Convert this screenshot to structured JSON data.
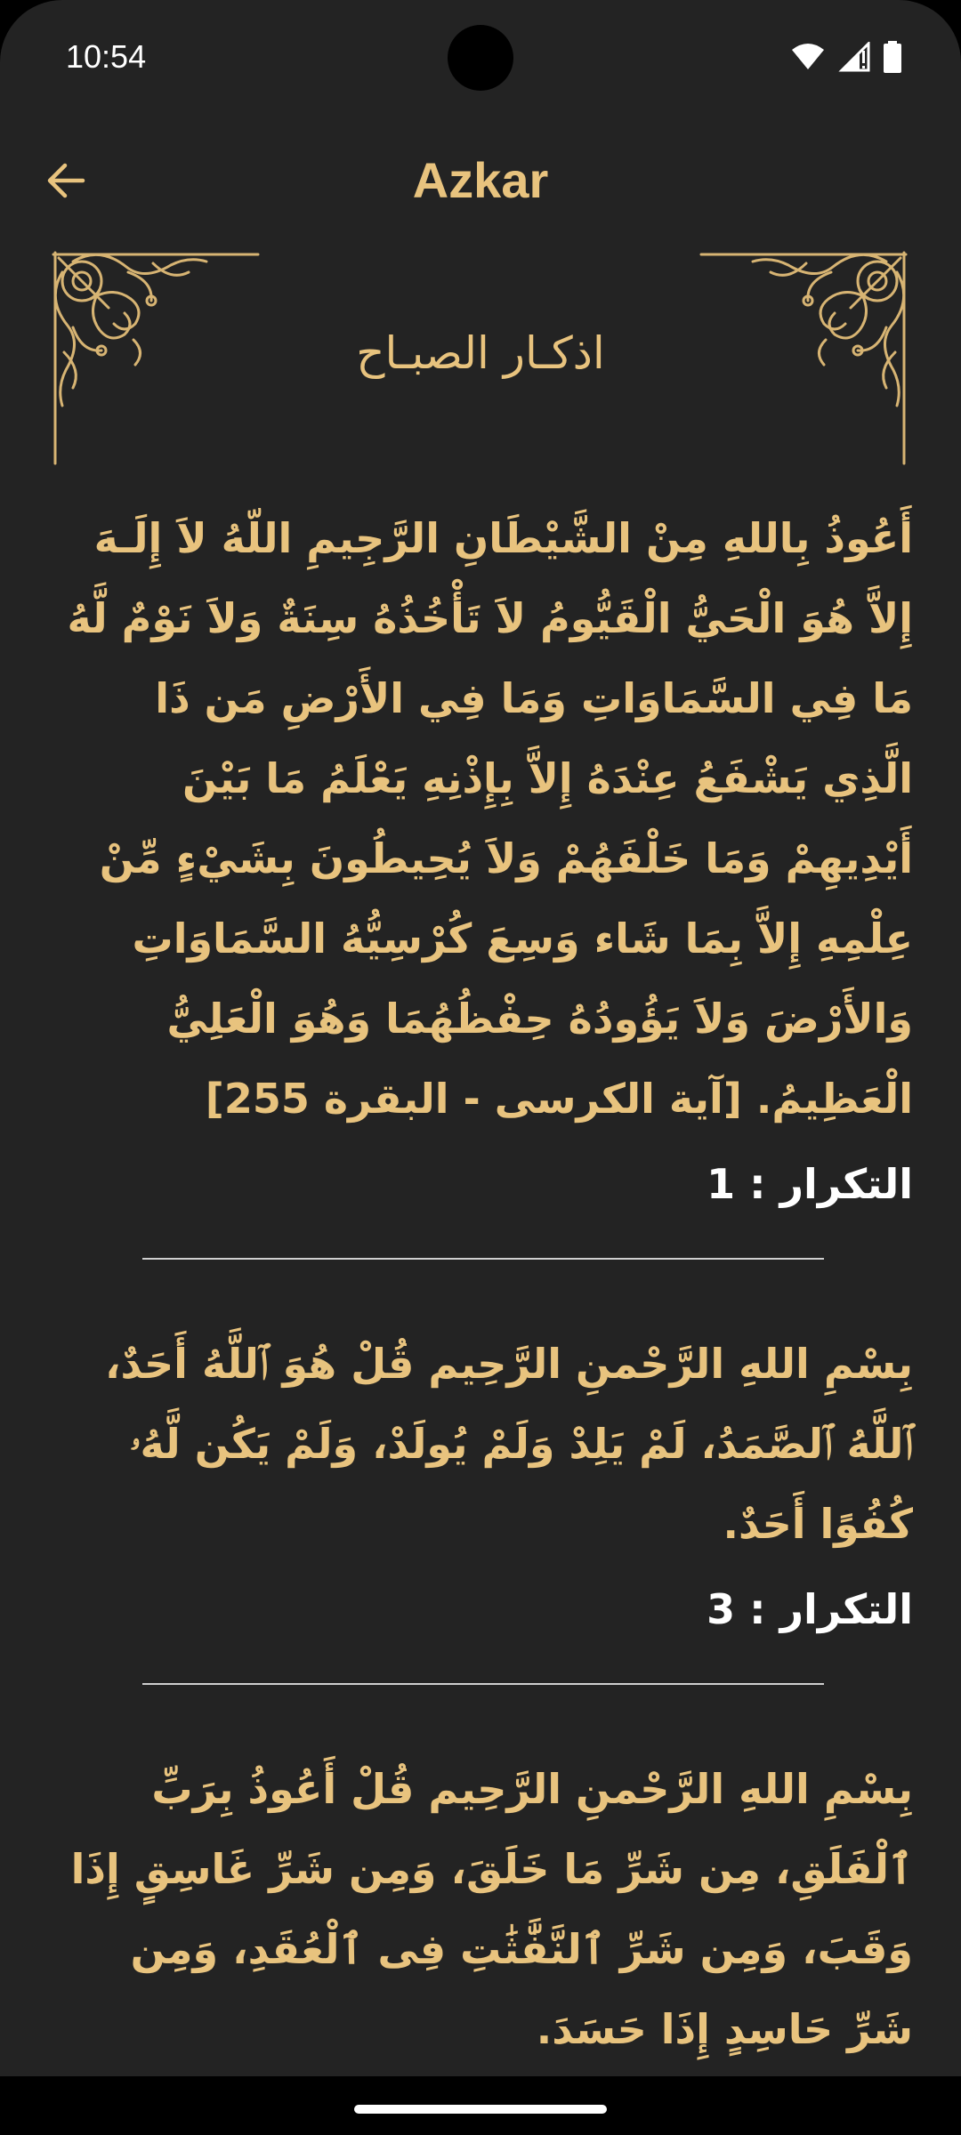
{
  "status_bar": {
    "time": "10:54"
  },
  "app_bar": {
    "title": "Azkar",
    "back_icon": "arrow-back-icon"
  },
  "header": {
    "title": "اذكـار الصبـاح",
    "ornament": "corner-ornament-icon"
  },
  "azkar": [
    {
      "text": "أَعُوذُ بِاللهِ مِنْ الشَّيْطَانِ الرَّجِيمِ اللّهُ لاَ إِلَـهَ إِلاَّ هُوَ الْحَيُّ الْقَيُّومُ لاَ تَأْخُذُهُ سِنَةٌ وَلاَ نَوْمٌ لَّهُ مَا فِي السَّمَاوَاتِ وَمَا فِي الأَرْضِ مَن ذَا الَّذِي يَشْفَعُ عِنْدَهُ إِلاَّ بِإِذْنِهِ يَعْلَمُ مَا بَيْنَ أَيْدِيهِمْ وَمَا خَلْفَهُمْ وَلاَ يُحِيطُونَ بِشَيْءٍ مِّنْ عِلْمِهِ إِلاَّ بِمَا شَاء وَسِعَ كُرْسِيُّهُ السَّمَاوَاتِ وَالأَرْضَ وَلاَ يَؤُودُهُ حِفْظُهُمَا وَهُوَ الْعَلِيُّ الْعَظِيمُ. [آية الكرسى - البقرة 255]",
      "repeat": "التكرار : 1"
    },
    {
      "text": "بِسْمِ اللهِ الرَّحْمنِ الرَّحِيم قُلْ هُوَ ٱللَّهُ أَحَدٌ، ٱللَّهُ ٱلصَّمَدُ، لَمْ يَلِدْ وَلَمْ يُولَدْ، وَلَمْ يَكُن لَّهُۥ كُفُوًا أَحَدٌ.",
      "repeat": "التكرار : 3"
    },
    {
      "text": "بِسْمِ اللهِ الرَّحْمنِ الرَّحِيم قُلْ أَعُوذُ بِرَبِّ ٱلْفَلَقِ، مِن شَرِّ مَا خَلَقَ، وَمِن شَرِّ غَاسِقٍ إِذَا وَقَبَ، وَمِن شَرِّ ٱلنَّفَّٰثَٰتِ فِى ٱلْعُقَدِ، وَمِن شَرِّ حَاسِدٍ إِذَا حَسَدَ.",
      "repeat": ""
    }
  ],
  "colors": {
    "background": "#232323",
    "accent": "#e8c37e",
    "text_secondary": "#ffffff"
  }
}
